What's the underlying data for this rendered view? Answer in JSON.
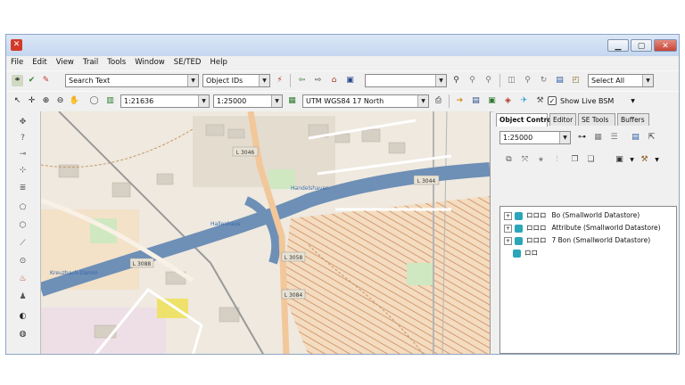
{
  "window": {
    "app_icon": "app-icon",
    "controls": [
      "minimize",
      "maximize",
      "close"
    ]
  },
  "menu": [
    "File",
    "Edit",
    "View",
    "Trail",
    "Tools",
    "Window",
    "SE/TED",
    "Help"
  ],
  "toolbar1": {
    "search_placeholder": "Search Text",
    "object_ids": "Object IDs",
    "location_value": "",
    "select_all": "Select All"
  },
  "toolbar2": {
    "scale1": "1:21636",
    "scale2": "1:25000",
    "projection": "UTM WGS84 17 North",
    "show_live_bsm": "Show Live BSM"
  },
  "panel": {
    "tabs": [
      "Object Control",
      "Editor",
      "SE Tools",
      "Buffers"
    ],
    "scale": "1:25000",
    "tree": [
      {
        "code": "ロロロ",
        "label": "Bo (Smallworld Datastore)"
      },
      {
        "code": "ロロロ",
        "label": "Attribute (Smallworld Datastore)"
      },
      {
        "code": "ロロロ",
        "label": "7 Bon (Smallworld Datastore)"
      },
      {
        "code": "ロロ",
        "label": ""
      }
    ]
  },
  "map": {
    "road_labels": [
      "L 3046",
      "L 3044",
      "L 3088",
      "L 3058",
      "L 3084"
    ],
    "place_labels": [
      "Handelshaven",
      "Hallenhaus",
      "Kreuzbach-Damm"
    ]
  },
  "colors": {
    "river": "#6e8fb6",
    "road": "#f2c79a",
    "highlight": "#d7a98a"
  }
}
